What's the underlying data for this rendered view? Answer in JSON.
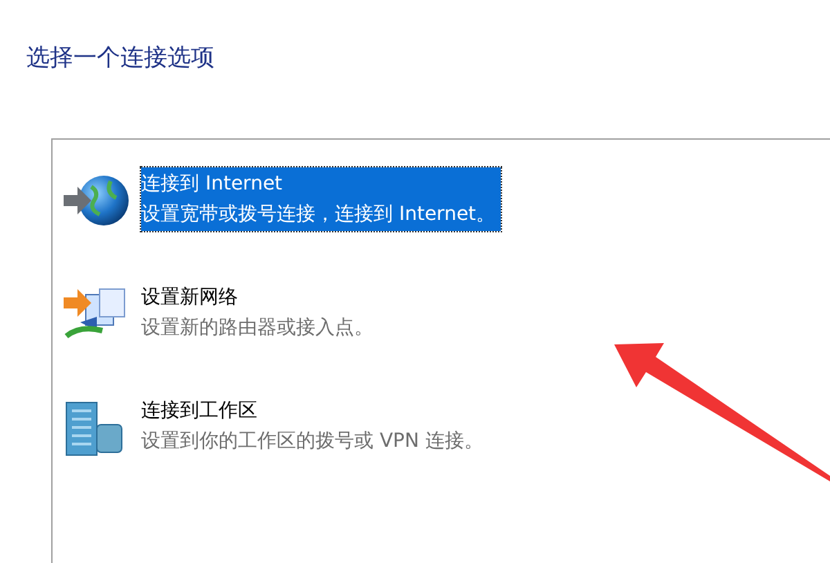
{
  "heading": "选择一个连接选项",
  "options": [
    {
      "kind": "internet",
      "title": "连接到 Internet",
      "description": "设置宽带或拨号连接，连接到 Internet。",
      "selected": true
    },
    {
      "kind": "new-network",
      "title": "设置新网络",
      "description": "设置新的路由器或接入点。",
      "selected": false
    },
    {
      "kind": "workplace",
      "title": "连接到工作区",
      "description": "设置到你的工作区的拨号或 VPN 连接。",
      "selected": false
    }
  ]
}
